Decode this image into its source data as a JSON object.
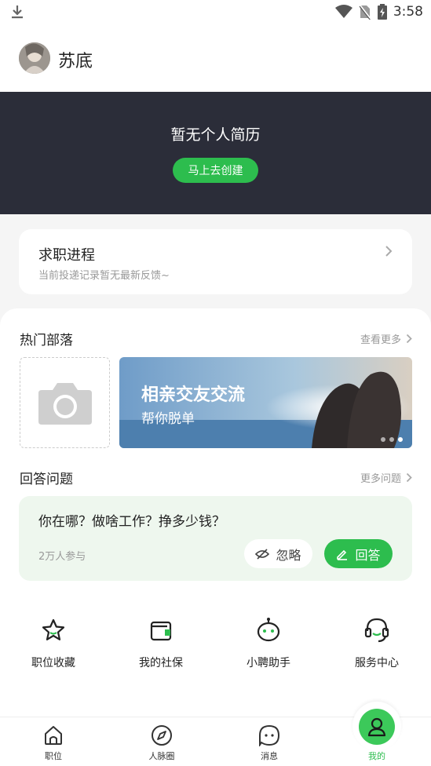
{
  "status_bar": {
    "time": "3:58"
  },
  "profile": {
    "name": "苏底"
  },
  "resume": {
    "title": "暂无个人简历",
    "create_label": "马上去创建"
  },
  "job_progress": {
    "title": "求职进程",
    "subtitle": "当前投递记录暂无最新反馈~"
  },
  "tribes": {
    "title": "热门部落",
    "more_label": "查看更多",
    "banner": {
      "title": "相亲交友交流",
      "subtitle": "帮你脱单"
    }
  },
  "questions": {
    "title": "回答问题",
    "more_label": "更多问题",
    "question": "你在哪？做啥工作？挣多少钱？",
    "participants": "2万人参与",
    "ignore_label": "忽略",
    "answer_label": "回答"
  },
  "shortcuts": [
    {
      "label": "职位收藏",
      "icon": "star-icon"
    },
    {
      "label": "我的社保",
      "icon": "wallet-icon"
    },
    {
      "label": "小聘助手",
      "icon": "robot-icon"
    },
    {
      "label": "服务中心",
      "icon": "headset-icon"
    }
  ],
  "tabs": [
    {
      "label": "职位",
      "icon": "home-icon"
    },
    {
      "label": "人脉圈",
      "icon": "compass-icon"
    },
    {
      "label": "消息",
      "icon": "chat-icon"
    },
    {
      "label": "我的",
      "icon": "user-icon",
      "active": true
    }
  ],
  "colors": {
    "accent": "#2dbd4e",
    "dark_banner": "#2b2d39",
    "qa_bg": "#eef7ee"
  }
}
